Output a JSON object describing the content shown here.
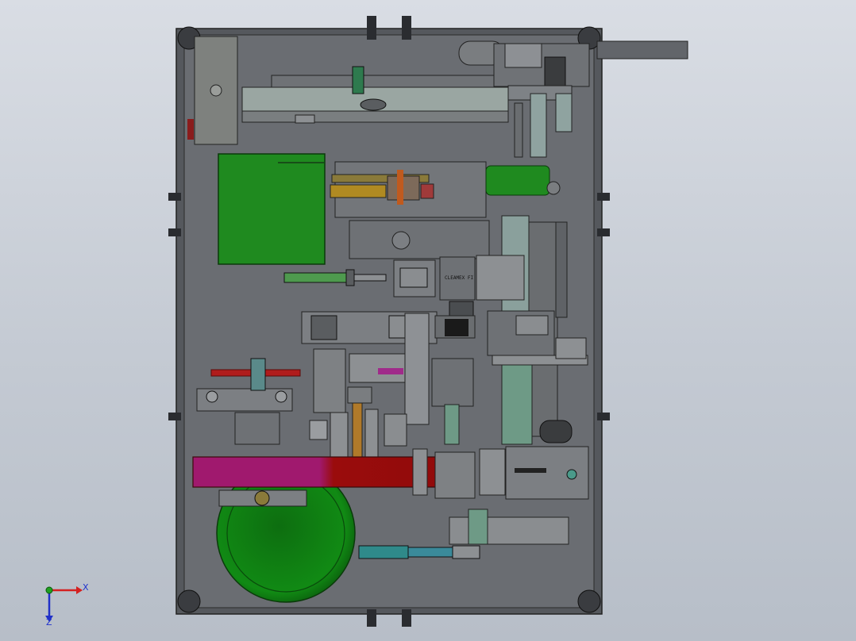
{
  "viewport": {
    "background_top": "#d9dde4",
    "background_bottom": "#b7bec8"
  },
  "model": {
    "frame_color": "#5b5e63",
    "plate_color": "#6a6d72",
    "accent_green": "#1f8a1f",
    "accent_red": "#9a0c0c",
    "accent_magenta": "#a0196e",
    "component_labels": [
      "CLEAMEX FI"
    ]
  },
  "triad": {
    "x_label": "X",
    "z_label": "Z",
    "x_color": "#d42020",
    "z_color": "#2030c8",
    "y_color": "#20a020"
  }
}
